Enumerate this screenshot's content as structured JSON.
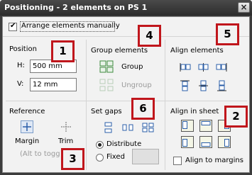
{
  "window": {
    "title": "Positioning - 2 elements on PS 1",
    "close_icon": "close-x"
  },
  "arrange": {
    "label": "Arrange elements manually",
    "checked": true
  },
  "position": {
    "heading": "Position",
    "h_label": "H:",
    "h_value": "500 mm",
    "v_label": "V:",
    "v_value": "12 mm"
  },
  "group": {
    "heading": "Group elements",
    "group_label": "Group",
    "ungroup_label": "Ungroup"
  },
  "align": {
    "heading": "Align elements"
  },
  "reference": {
    "heading": "Reference",
    "margin_label": "Margin",
    "trim_label": "Trim",
    "hint": "(Alt to togg"
  },
  "gaps": {
    "heading": "Set gaps",
    "distribute_label": "Distribute",
    "fixed_label": "Fixed",
    "fixed_value": "",
    "selected": "Distribute"
  },
  "sheet": {
    "heading": "Align in sheet",
    "align_margins_label": "Align to margins",
    "align_margins_checked": false
  },
  "callouts": [
    "1",
    "2",
    "3",
    "4",
    "5",
    "6"
  ],
  "colors": {
    "callout_border": "#c0161c",
    "icon_blue": "#2a5ea8",
    "icon_green": "#3d8a3d",
    "titlebar": "#333333"
  }
}
